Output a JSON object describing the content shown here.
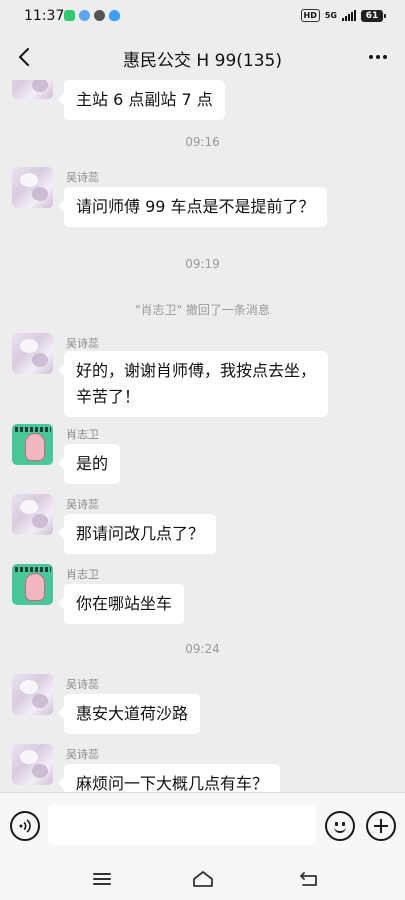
{
  "status_bar": {
    "time": "11:37",
    "network": "5G",
    "battery": "61",
    "hd": "HD",
    "app_icon_colors": [
      "#2ecc71",
      "#5aa7f0",
      "#555555",
      "#3aa0ff"
    ]
  },
  "header": {
    "title": "惠民公交 H 99(135)",
    "back_icon": "chevron-left-icon",
    "more_icon": "more-dots-icon"
  },
  "messages": {
    "m0": {
      "text": "主站 6 点副站 7 点"
    },
    "t1": {
      "text": "09:16"
    },
    "m1": {
      "sender": "吴诗蕊",
      "text": "请问师傅 99 车点是不是提前了？"
    },
    "t2": {
      "text": "09:19"
    },
    "s1": {
      "text": "\"肖志卫\" 撤回了一条消息"
    },
    "m2": {
      "sender": "吴诗蕊",
      "line1": "好的，谢谢肖师傅，我按点去坐，",
      "line2": "辛苦了！"
    },
    "m3": {
      "sender": "肖志卫",
      "text": "是的"
    },
    "m4": {
      "sender": "吴诗蕊",
      "text": "那请问改几点了？"
    },
    "m5": {
      "sender": "肖志卫",
      "text": "你在哪站坐车"
    },
    "t3": {
      "text": "09:24"
    },
    "m6": {
      "sender": "吴诗蕊",
      "text": "惠安大道荷沙路"
    },
    "m7": {
      "sender": "吴诗蕊",
      "text": "麻烦问一下大概几点有车？"
    }
  },
  "input_bar": {
    "voice_icon": "voice-icon",
    "emoji_icon": "emoji-icon",
    "plus_icon": "plus-icon",
    "input_value": ""
  },
  "system_nav": {
    "menu_icon": "menu-icon",
    "home_icon": "home-icon",
    "back_icon": "back-arrow-icon"
  },
  "colors": {
    "background": "#ededed",
    "bubble": "#ffffff",
    "meta_text": "#9a9a9a"
  }
}
